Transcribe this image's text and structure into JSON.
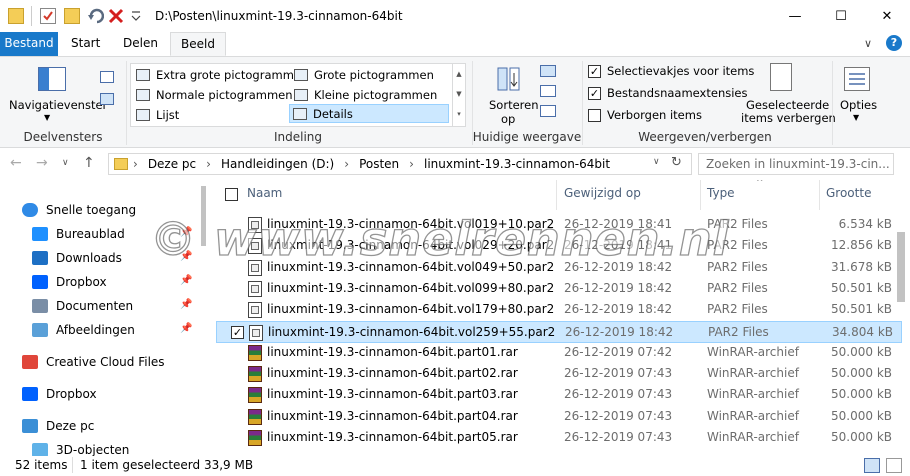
{
  "window": {
    "title": "D:\\Posten\\linuxmint-19.3-cinnamon-64bit",
    "minimize_glyph": "—",
    "maximize_glyph": "☐",
    "close_glyph": "✕"
  },
  "tabs": [
    {
      "label": "Bestand"
    },
    {
      "label": "Start"
    },
    {
      "label": "Delen"
    },
    {
      "label": "Beeld"
    }
  ],
  "ribbon": {
    "help_glyph": "?",
    "collapse_glyph": "∨",
    "panes": {
      "nav_pane_label": "Navigatievenster",
      "group_label": "Deelvensters"
    },
    "layout": {
      "items": [
        {
          "label": "Extra grote pictogrammen"
        },
        {
          "label": "Grote pictogrammen"
        },
        {
          "label": "Normale pictogrammen"
        },
        {
          "label": "Kleine pictogrammen"
        },
        {
          "label": "Lijst"
        },
        {
          "label": "Details"
        }
      ],
      "group_label": "Indeling"
    },
    "current_view": {
      "sort_label_1": "Sorteren",
      "sort_label_2": "op",
      "group_label": "Huidige weergave"
    },
    "show_hide": {
      "checkboxes": [
        {
          "label": "Selectievakjes voor items",
          "checked": true
        },
        {
          "label": "Bestandsnaamextensies",
          "checked": true
        },
        {
          "label": "Verborgen items",
          "checked": false
        }
      ],
      "hide_selected_1": "Geselecteerde",
      "hide_selected_2": "items verbergen",
      "group_label": "Weergeven/verbergen"
    },
    "options_label": "Opties"
  },
  "address": {
    "crumbs": [
      "Deze pc",
      "Handleidingen (D:)",
      "Posten",
      "linuxmint-19.3-cinnamon-64bit"
    ],
    "search_placeholder": "Zoeken in linuxmint-19.3-cin..."
  },
  "nav": {
    "items": [
      {
        "label": "Snelle toegang",
        "icon": "star-icon",
        "color": "#2f8ae6"
      },
      {
        "label": "Bureaublad",
        "icon": "desktop-icon",
        "color": "#1e90ff"
      },
      {
        "label": "Downloads",
        "icon": "download-icon",
        "color": "#1d6fc4"
      },
      {
        "label": "Dropbox",
        "icon": "dropbox-icon",
        "color": "#0061fe"
      },
      {
        "label": "Documenten",
        "icon": "document-icon",
        "color": "#7a8ea6"
      },
      {
        "label": "Afbeeldingen",
        "icon": "image-icon",
        "color": "#5aa0d8"
      },
      {
        "label": "Creative Cloud Files",
        "icon": "creative-cloud-icon",
        "color": "#e0463a"
      },
      {
        "label": "Dropbox",
        "icon": "dropbox-icon",
        "color": "#0061fe"
      },
      {
        "label": "Deze pc",
        "icon": "computer-icon",
        "color": "#3b8fd6"
      },
      {
        "label": "3D-objecten",
        "icon": "3d-objects-icon",
        "color": "#5fb2e8"
      }
    ]
  },
  "columns": {
    "name": "Naam",
    "modified": "Gewijzigd op",
    "type": "Type",
    "size": "Grootte"
  },
  "files": [
    {
      "name": "linuxmint-19.3-cinnamon-64bit.vol019+10.par2",
      "modified": "26-12-2019 18:41",
      "type": "PAR2 Files",
      "size": "6.534 kB",
      "kind": "par2",
      "selected": false
    },
    {
      "name": "linuxmint-19.3-cinnamon-64bit.vol029+20.par2",
      "modified": "26-12-2019 18:41",
      "type": "PAR2 Files",
      "size": "12.856 kB",
      "kind": "par2",
      "selected": false
    },
    {
      "name": "linuxmint-19.3-cinnamon-64bit.vol049+50.par2",
      "modified": "26-12-2019 18:42",
      "type": "PAR2 Files",
      "size": "31.678 kB",
      "kind": "par2",
      "selected": false
    },
    {
      "name": "linuxmint-19.3-cinnamon-64bit.vol099+80.par2",
      "modified": "26-12-2019 18:42",
      "type": "PAR2 Files",
      "size": "50.501 kB",
      "kind": "par2",
      "selected": false
    },
    {
      "name": "linuxmint-19.3-cinnamon-64bit.vol179+80.par2",
      "modified": "26-12-2019 18:42",
      "type": "PAR2 Files",
      "size": "50.501 kB",
      "kind": "par2",
      "selected": false
    },
    {
      "name": "linuxmint-19.3-cinnamon-64bit.vol259+55.par2",
      "modified": "26-12-2019 18:42",
      "type": "PAR2 Files",
      "size": "34.804 kB",
      "kind": "par2",
      "selected": true
    },
    {
      "name": "linuxmint-19.3-cinnamon-64bit.part01.rar",
      "modified": "26-12-2019 07:42",
      "type": "WinRAR-archief",
      "size": "50.000 kB",
      "kind": "rar",
      "selected": false
    },
    {
      "name": "linuxmint-19.3-cinnamon-64bit.part02.rar",
      "modified": "26-12-2019 07:43",
      "type": "WinRAR-archief",
      "size": "50.000 kB",
      "kind": "rar",
      "selected": false
    },
    {
      "name": "linuxmint-19.3-cinnamon-64bit.part03.rar",
      "modified": "26-12-2019 07:43",
      "type": "WinRAR-archief",
      "size": "50.000 kB",
      "kind": "rar",
      "selected": false
    },
    {
      "name": "linuxmint-19.3-cinnamon-64bit.part04.rar",
      "modified": "26-12-2019 07:43",
      "type": "WinRAR-archief",
      "size": "50.000 kB",
      "kind": "rar",
      "selected": false
    },
    {
      "name": "linuxmint-19.3-cinnamon-64bit.part05.rar",
      "modified": "26-12-2019 07:43",
      "type": "WinRAR-archief",
      "size": "50.000 kB",
      "kind": "rar",
      "selected": false
    }
  ],
  "status": {
    "count": "52 items",
    "selection": "1 item geselecteerd 33,9 MB"
  },
  "watermark": "© www.snelrennen.nl",
  "colors": {
    "accent": "#1979ca",
    "selection": "#cce8ff",
    "selection_border": "#99d1ff"
  }
}
